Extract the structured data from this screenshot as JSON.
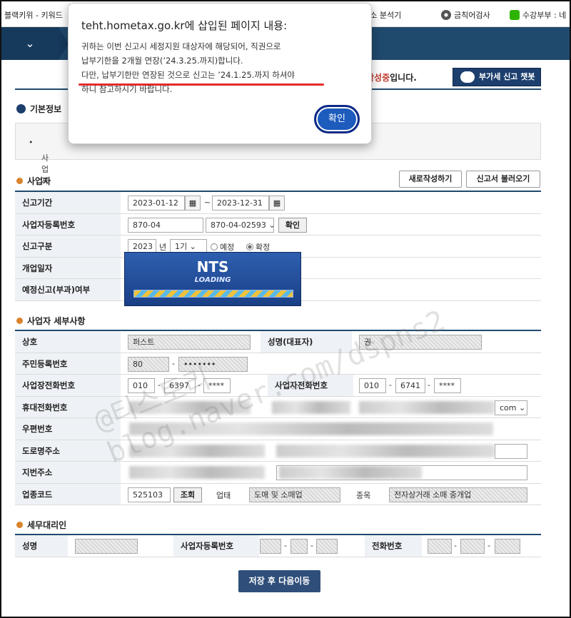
{
  "bookmarks": {
    "left_a": "블랙키위",
    "left_b": "키워드",
    "right1": "형태소 분석기",
    "right2": "금칙어검사",
    "right3": "수강부부 : 네"
  },
  "status": {
    "prefix": "작성중",
    "suffix": "입니다."
  },
  "chat_button": "부가세 신고 챗봇",
  "basic_info": {
    "title": "기본정보",
    "note": "사업자"
  },
  "business": {
    "title": "사업자",
    "new_button": "새로작성하기",
    "load_button": "신고서 불러오기",
    "rows": {
      "period_label": "신고기간",
      "period_start": "2023-01-12",
      "period_sep": "~",
      "period_end": "2023-12-31",
      "regno_label": "사업자등록번호",
      "regno_value": "870-04",
      "regno_select": "870-04-02593",
      "regno_confirm": "확인",
      "type_label": "신고구분",
      "type_year": "2023",
      "type_year_unit": "년",
      "type_term": "1기",
      "type_opt1": "예정",
      "type_opt2": "확정",
      "open_label": "개업일자",
      "prelim_label": "예정신고(부과)여부"
    }
  },
  "tax": {
    "title": "사업자 세부사항",
    "name_label": "상호",
    "name_value": "퍼스트",
    "rep_label": "성명(대표자)",
    "rep_value": "권",
    "rrn_label": "주민등록번호",
    "rrn_front": "80",
    "rrn_sep": "-",
    "rrn_back": "•••••••",
    "bizphone_label": "사업장전화번호",
    "bizphone": [
      "010",
      "6397",
      "****"
    ],
    "ownerphone_label": "사업자전화번호",
    "ownerphone": [
      "010",
      "6741",
      "****"
    ],
    "mobile_label": "휴대전화번호",
    "email_domain": "com",
    "zip_label": "우편번호",
    "road_label": "도로명주소",
    "lot_label": "지번주소",
    "code_label": "업종코드",
    "code_value": "525103",
    "code_search": "조회",
    "biz_type_label": "업태",
    "biz_type_value": "도매 및 소매업",
    "item_label": "종목",
    "item_value": "전자상거래 소매 중개업"
  },
  "agent": {
    "title": "세무대리인",
    "name_label": "성명",
    "reg_label": "사업자등록번호",
    "phone_label": "전화번호",
    "sep": "-"
  },
  "loading": {
    "title": "NTS",
    "subtitle": "LOADING",
    "progress": 1.0
  },
  "watermark": {
    "line1": "@티스토리",
    "line2": "blog.naver.com/dspns2"
  },
  "save_button": "저장 후 다음이동",
  "dialog": {
    "title": "teht.hometax.go.kr에 삽입된 페이지 내용:",
    "line1": "귀하는 이번 신고시 세정지원 대상자에 해당되어, 직권으로",
    "line2": "납부기한을 2개월 연장(’24.3.25.까지)합니다.",
    "line3": "다만, 납부기한만 연장된 것으로 신고는 ’24.1.25.까지 하셔야",
    "line4": "하니 참고하시기 바랍니다.",
    "ok": "확인"
  },
  "colors": {
    "navy": "#20496e",
    "highlight_red": "#e52a2a",
    "ok_blue": "#1d5bbd"
  }
}
